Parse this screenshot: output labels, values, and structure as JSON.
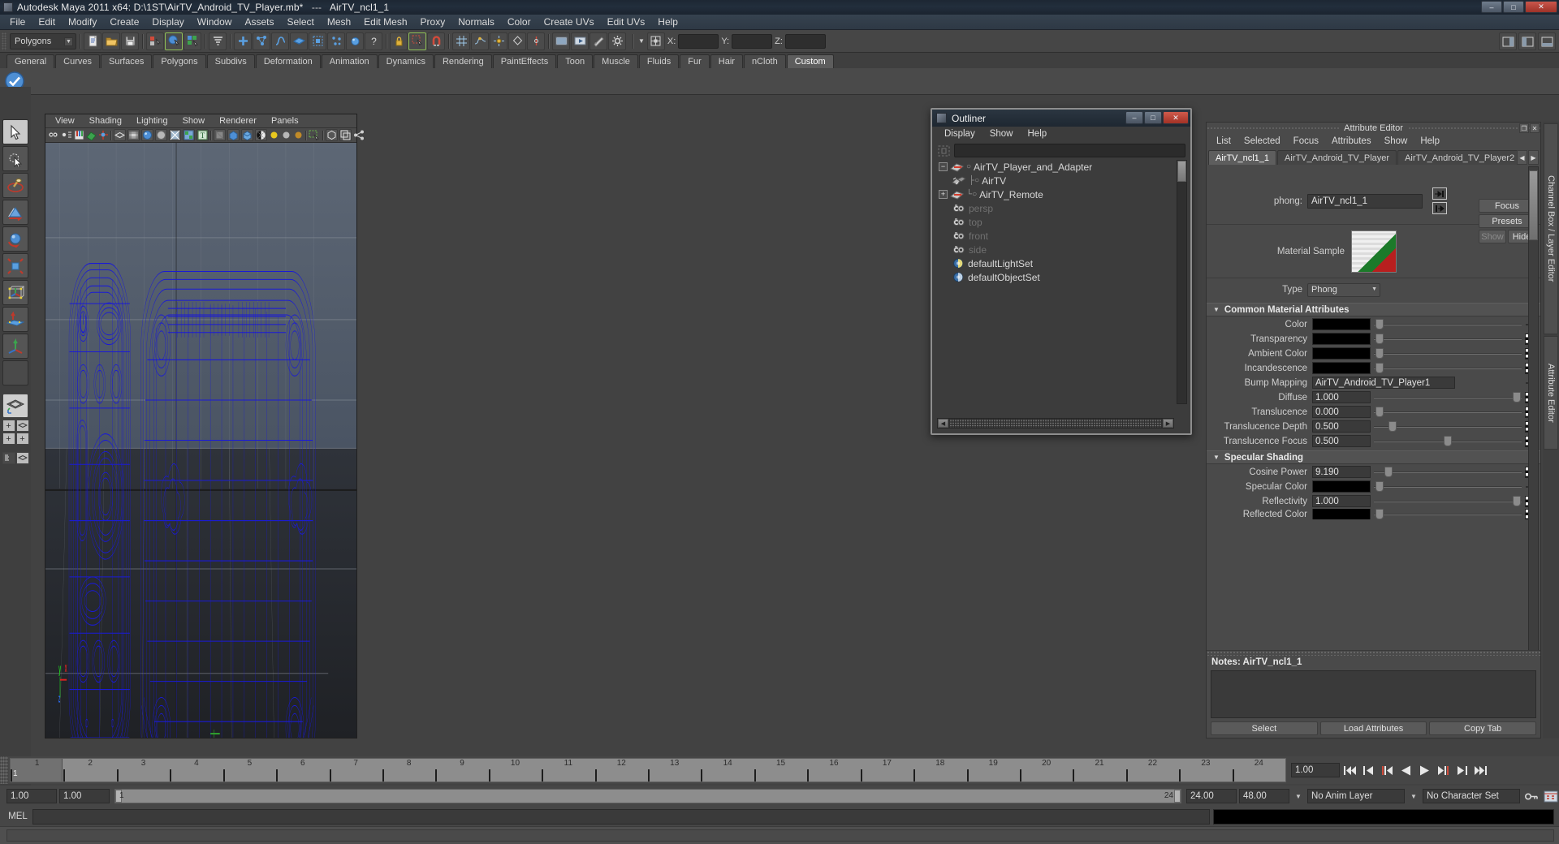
{
  "window": {
    "title": "Autodesk Maya 2011 x64: D:\\1ST\\AirTV_Android_TV_Player.mb*",
    "separator": "---",
    "node": "AirTV_ncl1_1",
    "minimize": "–",
    "maximize": "□",
    "close": "✕"
  },
  "menubar": {
    "items": [
      "File",
      "Edit",
      "Modify",
      "Create",
      "Display",
      "Window",
      "Assets",
      "Select",
      "Mesh",
      "Edit Mesh",
      "Proxy",
      "Normals",
      "Color",
      "Create UVs",
      "Edit UVs",
      "Help"
    ]
  },
  "statusline": {
    "mode_selector": "Polygons",
    "x_label": "X:",
    "y_label": "Y:",
    "z_label": "Z:",
    "x_value": "",
    "y_value": "",
    "z_value": ""
  },
  "shelf": {
    "tabs": [
      "General",
      "Curves",
      "Surfaces",
      "Polygons",
      "Subdivs",
      "Deformation",
      "Animation",
      "Dynamics",
      "Rendering",
      "PaintEffects",
      "Toon",
      "Muscle",
      "Fluids",
      "Fur",
      "Hair",
      "nCloth",
      "Custom"
    ],
    "active_tab": "Custom"
  },
  "viewport": {
    "menu": [
      "View",
      "Shading",
      "Lighting",
      "Show",
      "Renderer",
      "Panels"
    ],
    "axis": {
      "x": "x",
      "y": "y",
      "z": "z"
    }
  },
  "outliner": {
    "title": "Outliner",
    "menu": [
      "Display",
      "Show",
      "Help"
    ],
    "search_value": "",
    "items": [
      {
        "label": "AirTV_Player_and_Adapter",
        "expander": "−",
        "dim": false,
        "indent": 0,
        "icon": "transform-icon"
      },
      {
        "label": "AirTV",
        "expander": "",
        "dim": false,
        "indent": 1,
        "icon": "mesh-icon"
      },
      {
        "label": "AirTV_Remote",
        "expander": "+",
        "dim": false,
        "indent": 1,
        "icon": "transform-icon"
      },
      {
        "label": "persp",
        "expander": "",
        "dim": true,
        "indent": 1,
        "icon": "camera-icon"
      },
      {
        "label": "top",
        "expander": "",
        "dim": true,
        "indent": 1,
        "icon": "camera-icon"
      },
      {
        "label": "front",
        "expander": "",
        "dim": true,
        "indent": 1,
        "icon": "camera-icon"
      },
      {
        "label": "side",
        "expander": "",
        "dim": true,
        "indent": 1,
        "icon": "camera-icon"
      },
      {
        "label": "defaultLightSet",
        "expander": "",
        "dim": false,
        "indent": 1,
        "icon": "set-icon"
      },
      {
        "label": "defaultObjectSet",
        "expander": "",
        "dim": false,
        "indent": 1,
        "icon": "set-icon"
      }
    ]
  },
  "attribute_editor": {
    "title": "Attribute Editor",
    "menu": [
      "List",
      "Selected",
      "Focus",
      "Attributes",
      "Show",
      "Help"
    ],
    "tabs": [
      "AirTV_ncl1_1",
      "AirTV_Android_TV_Player",
      "AirTV_Android_TV_Player2"
    ],
    "active_tab": "AirTV_ncl1_1",
    "node_label": "phong:",
    "node_name": "AirTV_ncl1_1",
    "buttons": {
      "focus": "Focus",
      "presets": "Presets",
      "show": "Show",
      "hide": "Hide"
    },
    "material_sample_label": "Material Sample",
    "type_label": "Type",
    "type_value": "Phong",
    "sections": [
      {
        "title": "Common Material Attributes",
        "rows": [
          {
            "label": "Color",
            "kind": "color",
            "value": "#000000",
            "slider": 0.02,
            "map": "arrow"
          },
          {
            "label": "Transparency",
            "kind": "color",
            "value": "#000000",
            "slider": 0.02,
            "map": "checker"
          },
          {
            "label": "Ambient Color",
            "kind": "color",
            "value": "#000000",
            "slider": 0.02,
            "map": "checker"
          },
          {
            "label": "Incandescence",
            "kind": "color",
            "value": "#000000",
            "slider": 0.02,
            "map": "checker"
          },
          {
            "label": "Bump Mapping",
            "kind": "text",
            "value": "AirTV_Android_TV_Player1",
            "map": "arrow"
          },
          {
            "label": "Diffuse",
            "kind": "number",
            "value": "1.000",
            "slider": 0.95,
            "map": "checker"
          },
          {
            "label": "Translucence",
            "kind": "number",
            "value": "0.000",
            "slider": 0.02,
            "map": "checker"
          },
          {
            "label": "Translucence Depth",
            "kind": "number",
            "value": "0.500",
            "slider": 0.11,
            "map": "checker"
          },
          {
            "label": "Translucence Focus",
            "kind": "number",
            "value": "0.500",
            "slider": 0.48,
            "map": "checker"
          }
        ]
      },
      {
        "title": "Specular Shading",
        "rows": [
          {
            "label": "Cosine Power",
            "kind": "number",
            "value": "9.190",
            "slider": 0.08,
            "map": "checker"
          },
          {
            "label": "Specular Color",
            "kind": "color",
            "value": "#000000",
            "slider": 0.02,
            "map": "arrow"
          },
          {
            "label": "Reflectivity",
            "kind": "number",
            "value": "1.000",
            "slider": 0.95,
            "map": "checker"
          },
          {
            "label": "Reflected Color",
            "kind": "color",
            "value": "#000000",
            "slider": 0.02,
            "map": "checker"
          }
        ]
      }
    ],
    "notes_label": "Notes: AirTV_ncl1_1",
    "notes_value": "",
    "bottom_buttons": [
      "Select",
      "Load Attributes",
      "Copy Tab"
    ]
  },
  "right_tabs": [
    "Channel Box / Layer Editor",
    "Attribute Editor"
  ],
  "timeline": {
    "ticks": [
      1,
      2,
      3,
      4,
      5,
      6,
      7,
      8,
      9,
      10,
      11,
      12,
      13,
      14,
      15,
      16,
      17,
      18,
      19,
      20,
      21,
      22,
      23,
      24
    ],
    "current_frame_marker": "1",
    "current_time_value": "1.00",
    "playback": [
      "go-to-start-icon",
      "step-back-key-icon",
      "step-back-frame-icon",
      "play-backwards-icon",
      "play-forwards-icon",
      "step-forward-frame-icon",
      "step-forward-key-icon",
      "go-to-end-icon"
    ]
  },
  "range_slider": {
    "anim_start": "1.00",
    "range_start": "1.00",
    "range_bar_start": "1",
    "range_bar_end": "24",
    "range_end": "24.00",
    "anim_end": "48.00",
    "anim_layer": "No Anim Layer",
    "character_set": "No Character Set"
  },
  "mel": {
    "label": "MEL",
    "command_value": "",
    "command_placeholder": ""
  },
  "colors": {
    "wireframe": "#1818d0",
    "title_bar": "#1d2733",
    "panel_bg": "#4a4a4a",
    "viewport_top": "#5a6472",
    "viewport_bottom": "#232529",
    "accent_close": "#c9564b"
  }
}
